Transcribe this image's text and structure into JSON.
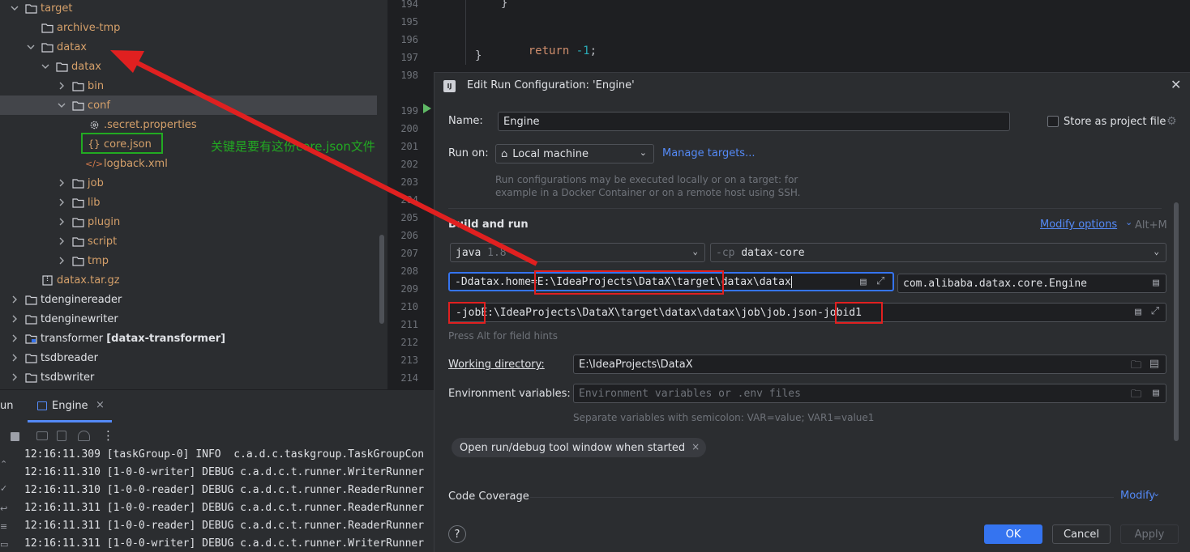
{
  "tree": {
    "items": [
      {
        "label": "target"
      },
      {
        "label": "archive-tmp"
      },
      {
        "label": "datax"
      },
      {
        "label": "datax"
      },
      {
        "label": "bin"
      },
      {
        "label": "conf"
      },
      {
        "label": ".secret.properties"
      },
      {
        "label": "core.json"
      },
      {
        "label": "logback.xml"
      },
      {
        "label": "job"
      },
      {
        "label": "lib"
      },
      {
        "label": "plugin"
      },
      {
        "label": "script"
      },
      {
        "label": "tmp"
      },
      {
        "label": "datax.tar.gz"
      },
      {
        "label": "tdenginereader"
      },
      {
        "label": "tdenginewriter"
      },
      {
        "label": "transformer",
        "module": "[datax-transformer]"
      },
      {
        "label": "tsdbreader"
      },
      {
        "label": "tsdbwriter"
      }
    ]
  },
  "annotation": {
    "note": "关键是要有这份core.json文件"
  },
  "editor": {
    "line_numbers": [
      "194",
      "195",
      "196",
      "197",
      "198",
      "199",
      "200",
      "201",
      "202",
      "203",
      "204",
      "205",
      "206",
      "207",
      "208",
      "209",
      "210",
      "211",
      "212",
      "213",
      "214"
    ],
    "code": {
      "brace_inner": "}",
      "return_kw": "return",
      "return_val": "-1",
      "return_semi": ";",
      "brace_outer": "}"
    }
  },
  "run": {
    "panel_label": "un",
    "tab_label": "Engine",
    "log_lines": [
      "12:16:11.309 [taskGroup-0] INFO  c.a.d.c.taskgroup.TaskGroupCon",
      "12:16:11.310 [1-0-0-writer] DEBUG c.a.d.c.t.runner.WriterRunner",
      "12:16:11.310 [1-0-0-reader] DEBUG c.a.d.c.t.runner.ReaderRunner",
      "12:16:11.311 [1-0-0-reader] DEBUG c.a.d.c.t.runner.ReaderRunner",
      "12:16:11.311 [1-0-0-reader] DEBUG c.a.d.c.t.runner.ReaderRunner",
      "12:16:11.311 [1-0-0-writer] DEBUG c.a.d.c.t.runner.WriterRunner"
    ]
  },
  "dialog": {
    "title": "Edit Run Configuration: 'Engine'",
    "name_label": "Name:",
    "name_value": "Engine",
    "store_label": "Store as project file",
    "run_on_label": "Run on:",
    "run_on_value": "Local machine",
    "manage_targets": "Manage targets...",
    "run_on_hint_1": "Run configurations may be executed locally or on a target: for",
    "run_on_hint_2": "example in a Docker Container or on a remote host using SSH.",
    "build_run_label": "Build and run",
    "modify_options": "Modify options",
    "modify_shortcut": "Alt+M",
    "jdk_name": "java",
    "jdk_version": "1.8",
    "cp_prefix": "-cp",
    "cp_value": "datax-core",
    "vm_opt_key": "-Ddatax.home=",
    "vm_opt_path1": "E:\\IdeaProjects\\DataX\\target",
    "vm_opt_path2": "\\datax\\datax",
    "main_class": "com.alibaba.datax.core.Engine",
    "prog_arg_job": "-job",
    "prog_arg_path": " E:\\IdeaProjects\\DataX\\target\\datax\\datax\\job\\job.json ",
    "prog_arg_jobid": "-jobid",
    "prog_arg_id": " 1",
    "field_hint": "Press Alt for field hints",
    "workdir_label": "Working directory:",
    "workdir_value": "E:\\IdeaProjects\\DataX",
    "env_label": "Environment variables:",
    "env_placeholder": "Environment variables or .env files",
    "env_hint": "Separate variables with semicolon: VAR=value; VAR1=value1",
    "chip_label": "Open run/debug tool window when started",
    "coverage_label": "Code Coverage",
    "coverage_modify": "Modify",
    "help": "?",
    "ok": "OK",
    "cancel": "Cancel",
    "apply": "Apply"
  },
  "colors": {
    "accent": "#3574f0",
    "annotation_red": "#e02020",
    "annotation_green": "#22aa22",
    "folder_orange": "#d5a06a"
  }
}
